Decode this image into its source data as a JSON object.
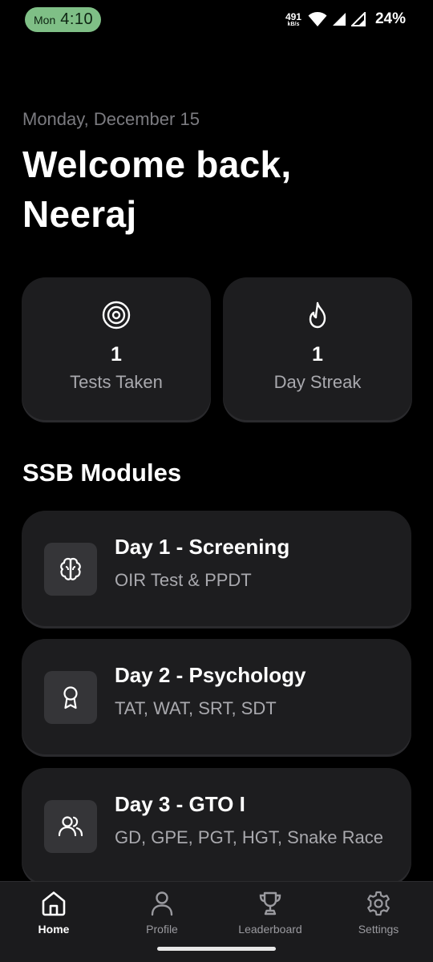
{
  "status_bar": {
    "day": "Mon",
    "time": "4:10",
    "net_speed": "491",
    "net_unit": "kB/s",
    "battery": "24%",
    "icons": [
      "wifi-icon",
      "signal-icon",
      "signal-icon",
      "battery-icon"
    ]
  },
  "header": {
    "date": "Monday, December 15",
    "welcome_line1": "Welcome back,",
    "welcome_line2": "Neeraj"
  },
  "stats": [
    {
      "icon": "target-icon",
      "value": "1",
      "label": "Tests Taken"
    },
    {
      "icon": "flame-icon",
      "value": "1",
      "label": "Day Streak"
    }
  ],
  "section_title": "SSB Modules",
  "modules": [
    {
      "icon": "brain-icon",
      "title": "Day 1 - Screening",
      "subtitle": "OIR Test & PPDT"
    },
    {
      "icon": "award-icon",
      "title": "Day 2 - Psychology",
      "subtitle": "TAT, WAT, SRT, SDT"
    },
    {
      "icon": "users-icon",
      "title": "Day 3 - GTO I",
      "subtitle": "GD, GPE, PGT, HGT, Snake Race"
    }
  ],
  "bottom_nav": {
    "active": "Home",
    "items": [
      {
        "icon": "home-icon",
        "label": "Home"
      },
      {
        "icon": "user-icon",
        "label": "Profile"
      },
      {
        "icon": "trophy-icon",
        "label": "Leaderboard"
      },
      {
        "icon": "gear-icon",
        "label": "Settings"
      }
    ]
  },
  "colors": {
    "background": "#000000",
    "card": "#1d1d1f",
    "icon_box": "#353538",
    "muted_text": "#a9a9ae",
    "clock_pill": "#7fbf86",
    "nav_bar": "#1b1b1d"
  }
}
